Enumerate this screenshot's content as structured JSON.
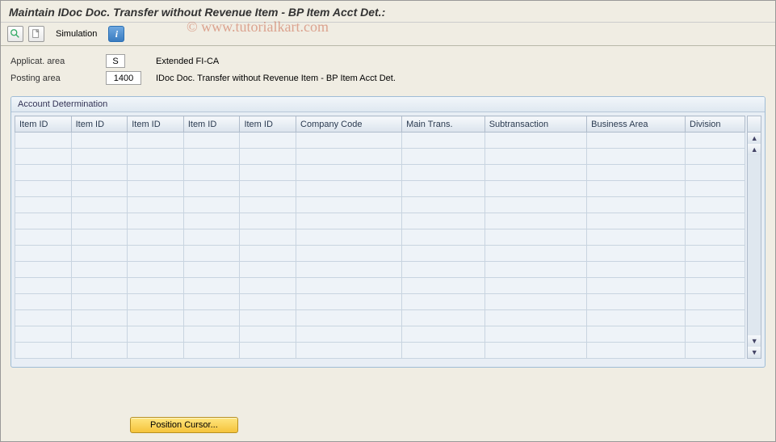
{
  "title": "Maintain IDoc Doc. Transfer without Revenue Item - BP Item Acct Det.:",
  "toolbar": {
    "simulation_label": "Simulation",
    "info_label": "i"
  },
  "fields": {
    "applicat_area_label": "Applicat. area",
    "applicat_area_value": "S",
    "applicat_area_desc": "Extended FI-CA",
    "posting_area_label": "Posting area",
    "posting_area_value": "1400",
    "posting_area_desc": "IDoc Doc. Transfer without Revenue Item - BP Item Acct Det."
  },
  "panel": {
    "title": "Account Determination",
    "columns": [
      "Item ID",
      "Item ID",
      "Item ID",
      "Item ID",
      "Item ID",
      "Company Code",
      "Main Trans.",
      "Subtransaction",
      "Business Area",
      "Division"
    ],
    "row_count": 14
  },
  "footer": {
    "position_cursor_label": "Position Cursor..."
  },
  "watermark": "© www.tutorialkart.com"
}
